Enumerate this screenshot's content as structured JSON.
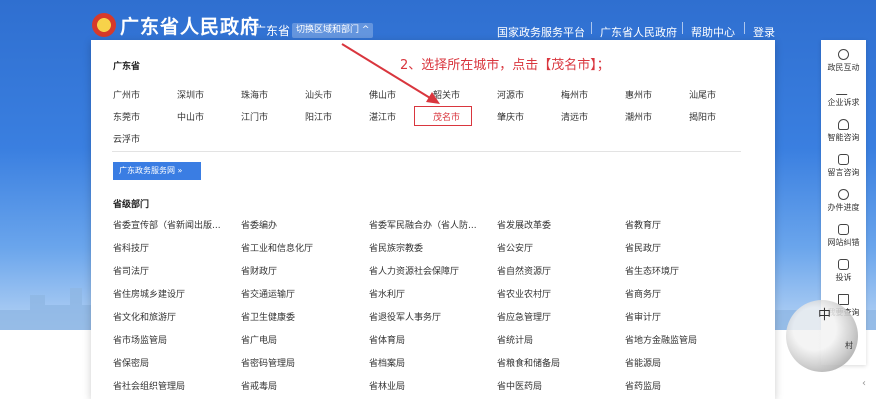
{
  "header": {
    "site_title": "广东省人民政府",
    "region_label": "广东省",
    "switch_label": "切换区域和部门 ^",
    "nav": [
      "国家政务服务平台",
      "广东省人民政府",
      "帮助中心",
      "登录"
    ]
  },
  "annotation": "2、选择所在城市，点击【茂名市】；",
  "province": {
    "title": "广东省",
    "cities_row1": [
      "广州市",
      "深圳市",
      "珠海市",
      "汕头市",
      "佛山市",
      "韶关市",
      "河源市",
      "梅州市",
      "惠州市",
      "汕尾市"
    ],
    "cities_row2": [
      "东莞市",
      "中山市",
      "江门市",
      "阳江市",
      "湛江市",
      "茂名市",
      "肇庆市",
      "清远市",
      "潮州市",
      "揭阳市"
    ],
    "cities_row3": [
      "云浮市"
    ],
    "highlighted_city": "茂名市"
  },
  "service_button": "广东政务服务网 »",
  "departments": {
    "title": "省级部门",
    "rows": [
      [
        "省委宣传部（省新闻出版...",
        "省委编办",
        "省委军民融合办（省人防...",
        "省发展改革委",
        "省教育厅"
      ],
      [
        "省科技厅",
        "省工业和信息化厅",
        "省民族宗教委",
        "省公安厅",
        "省民政厅"
      ],
      [
        "省司法厅",
        "省财政厅",
        "省人力资源社会保障厅",
        "省自然资源厅",
        "省生态环境厅"
      ],
      [
        "省住房城乡建设厅",
        "省交通运输厅",
        "省水利厅",
        "省农业农村厅",
        "省商务厅"
      ],
      [
        "省文化和旅游厅",
        "省卫生健康委",
        "省退役军人事务厅",
        "省应急管理厅",
        "省审计厅"
      ],
      [
        "省市场监管局",
        "省广电局",
        "省体育局",
        "省统计局",
        "省地方金融监管局"
      ],
      [
        "省保密局",
        "省密码管理局",
        "省档案局",
        "省粮食和储备局",
        "省能源局"
      ],
      [
        "省社会组织管理局",
        "省戒毒局",
        "省林业局",
        "省中医药局",
        "省药监局"
      ]
    ]
  },
  "sidebar": {
    "items": [
      "政民互动",
      "企业诉求",
      "智能咨询",
      "留言咨询",
      "办件进度",
      "网站纠错",
      "投诉",
      "我要查询"
    ]
  },
  "mascot": {
    "char": "中",
    "tail": "村"
  },
  "colors": {
    "header_blue": "#2e6fc7",
    "highlight_red": "#d9363e",
    "button_blue": "#3a7de3"
  }
}
